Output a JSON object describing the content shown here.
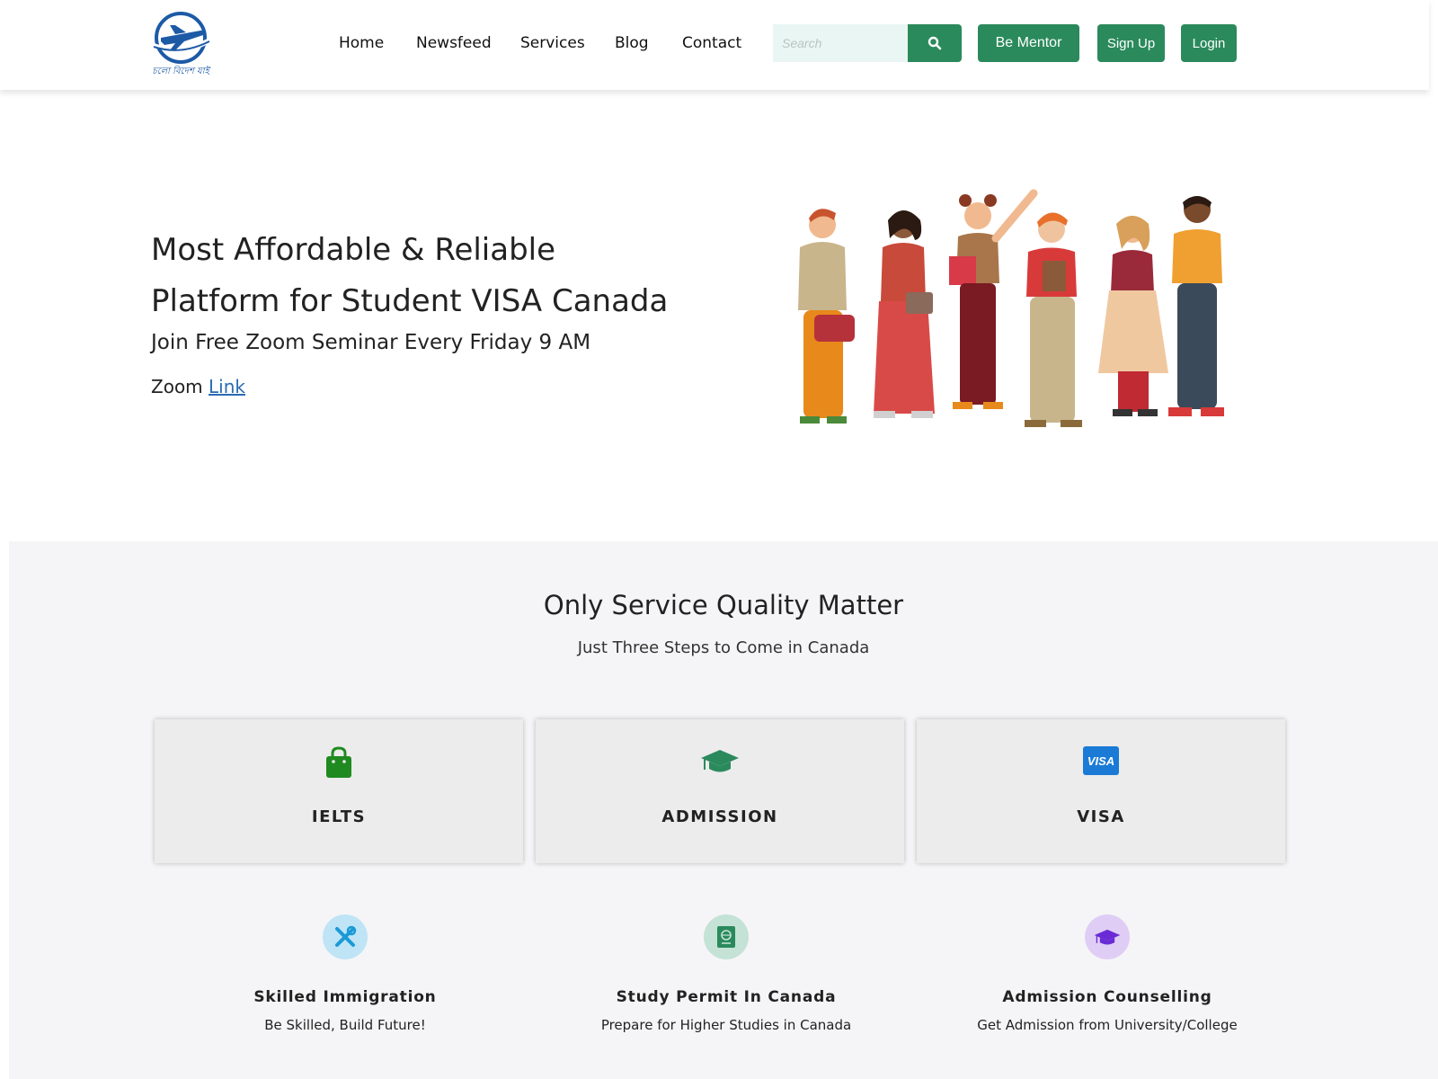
{
  "header": {
    "logo_text": "চলো বিদেশ যাই",
    "nav": [
      {
        "label": "Home"
      },
      {
        "label": "Newsfeed"
      },
      {
        "label": "Services"
      },
      {
        "label": "Blog"
      },
      {
        "label": "Contact"
      }
    ],
    "search": {
      "placeholder": "Search",
      "value": ""
    },
    "buttons": {
      "mentor": "Be Mentor",
      "signup": "Sign Up",
      "login": "Login"
    }
  },
  "hero": {
    "title_line1": "Most Affordable & Reliable",
    "title_line2": "Platform for Student VISA Canada",
    "subtitle": "Join Free Zoom Seminar Every Friday 9 AM",
    "zoom_label": "Zoom",
    "zoom_link": "Link"
  },
  "services": {
    "title": "Only Service Quality Matter",
    "subtitle": "Just Three Steps to Come in Canada",
    "cards": [
      {
        "label": "IELTS",
        "icon": "shopping-bag-icon"
      },
      {
        "label": "ADMISSION",
        "icon": "graduation-cap-icon"
      },
      {
        "label": "VISA",
        "icon": "visa-card-icon",
        "icon_text": "VISA"
      }
    ],
    "features": [
      {
        "title": "Skilled Immigration",
        "desc": "Be Skilled, Build Future!",
        "icon": "tools-icon",
        "color": "#1a9ad6"
      },
      {
        "title": "Study Permit In Canada",
        "desc": "Prepare for Higher Studies in Canada",
        "icon": "passport-icon",
        "color": "#2b8a5c"
      },
      {
        "title": "Admission Counselling",
        "desc": "Get Admission from University/College",
        "icon": "graduation-cap-icon",
        "color": "#6a2bd6"
      }
    ]
  },
  "colors": {
    "accent": "#2b8a5c",
    "link": "#2a6bb3",
    "section_bg": "#f5f5f7"
  }
}
